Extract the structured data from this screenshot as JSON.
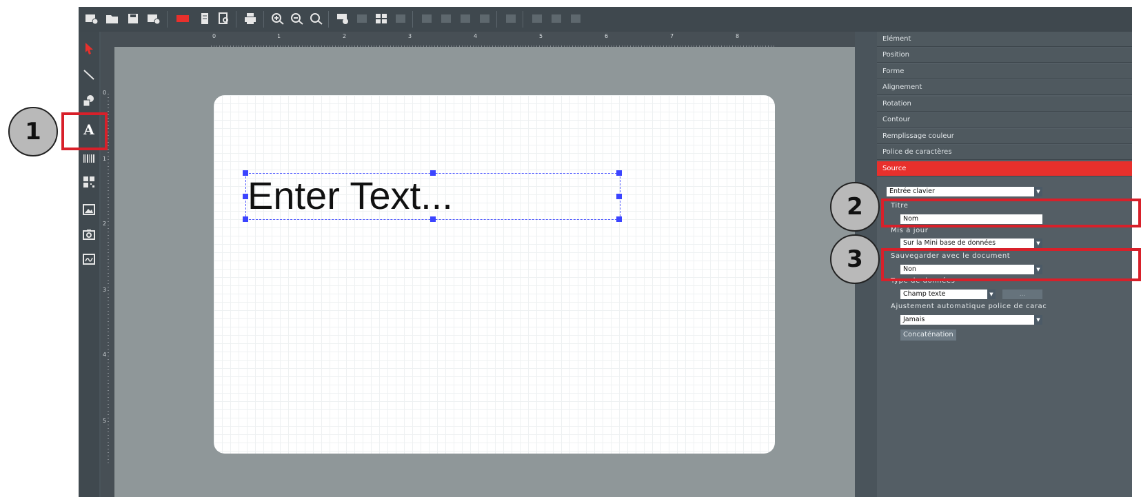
{
  "toolbar": {
    "icons": [
      "new-label-icon",
      "open-folder-icon",
      "save-icon",
      "close-doc-icon",
      "database-icon",
      "page-icon",
      "print-preview-icon",
      "printer-icon",
      "zoom-in-icon",
      "zoom-out-icon",
      "zoom-fit-icon",
      "barcode-tool-icon",
      "disabled-tool-icon",
      "grid-tool-icon",
      "align-left-icon",
      "align-right-icon",
      "align-top-icon",
      "align-bottom-icon",
      "distribute-icon",
      "layer-up-icon",
      "layer-down-icon"
    ]
  },
  "palette": {
    "tools": [
      "select-arrow-icon",
      "line-tool-icon",
      "shapes-tool-icon",
      "text-tool-icon",
      "barcode-tool-icon",
      "qrcode-tool-icon",
      "image-tool-icon",
      "camera-tool-icon",
      "signature-tool-icon"
    ],
    "text_tool_glyph": "A"
  },
  "ruler": {
    "h_numbers": [
      "0",
      "1",
      "2",
      "3",
      "4",
      "5",
      "6",
      "7",
      "8"
    ],
    "v_numbers": [
      "0",
      "1",
      "2",
      "3",
      "4",
      "5"
    ]
  },
  "canvas": {
    "text": "Enter Text..."
  },
  "panel": {
    "sections": [
      "Elément",
      "Position",
      "Forme",
      "Alignement",
      "Rotation",
      "Contour",
      "Remplissage couleur",
      "Police de caractères",
      "Source"
    ],
    "source_type": "Entrée clavier",
    "titre_label": "Titre",
    "titre_value": "Nom",
    "mis_a_jour_label": "Mis à jour",
    "mis_a_jour_value": "Sur la Mini base de données",
    "sauvegarder_label": "Sauvegarder avec le document",
    "sauvegarder_value": "Non",
    "type_label": "Type de données",
    "type_value": "Champ texte",
    "more_button": "...",
    "ajustement_label": "Ajustement automatique police de carac",
    "ajustement_value": "Jamais",
    "concat_button": "Concaténation"
  },
  "annotations": [
    "1",
    "2",
    "3"
  ],
  "colors": {
    "accent": "#e8302c",
    "highlight": "#d8202a",
    "handle": "#3b44ff"
  }
}
